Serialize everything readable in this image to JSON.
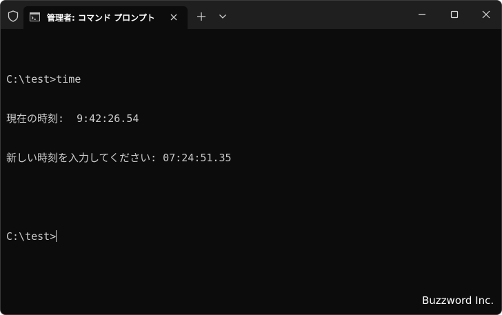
{
  "tab": {
    "title": "管理者: コマンド プロンプト"
  },
  "icons": {
    "shield": "shield-icon",
    "tab": "command-prompt-icon",
    "close_tab": "close-icon",
    "new_tab": "plus-icon",
    "dropdown": "chevron-down-icon",
    "minimize": "minimize-icon",
    "maximize": "maximize-icon",
    "close_window": "close-icon"
  },
  "console": {
    "lines": [
      "C:\\test>time",
      "現在の時刻:  9:42:26.54",
      "新しい時刻を入力してください: 07:24:51.35",
      "",
      "C:\\test>"
    ]
  },
  "watermark": "Buzzword Inc.",
  "colors": {
    "background": "#0c0c0c",
    "titlebar": "#1f1f1f",
    "text": "#cccccc"
  }
}
